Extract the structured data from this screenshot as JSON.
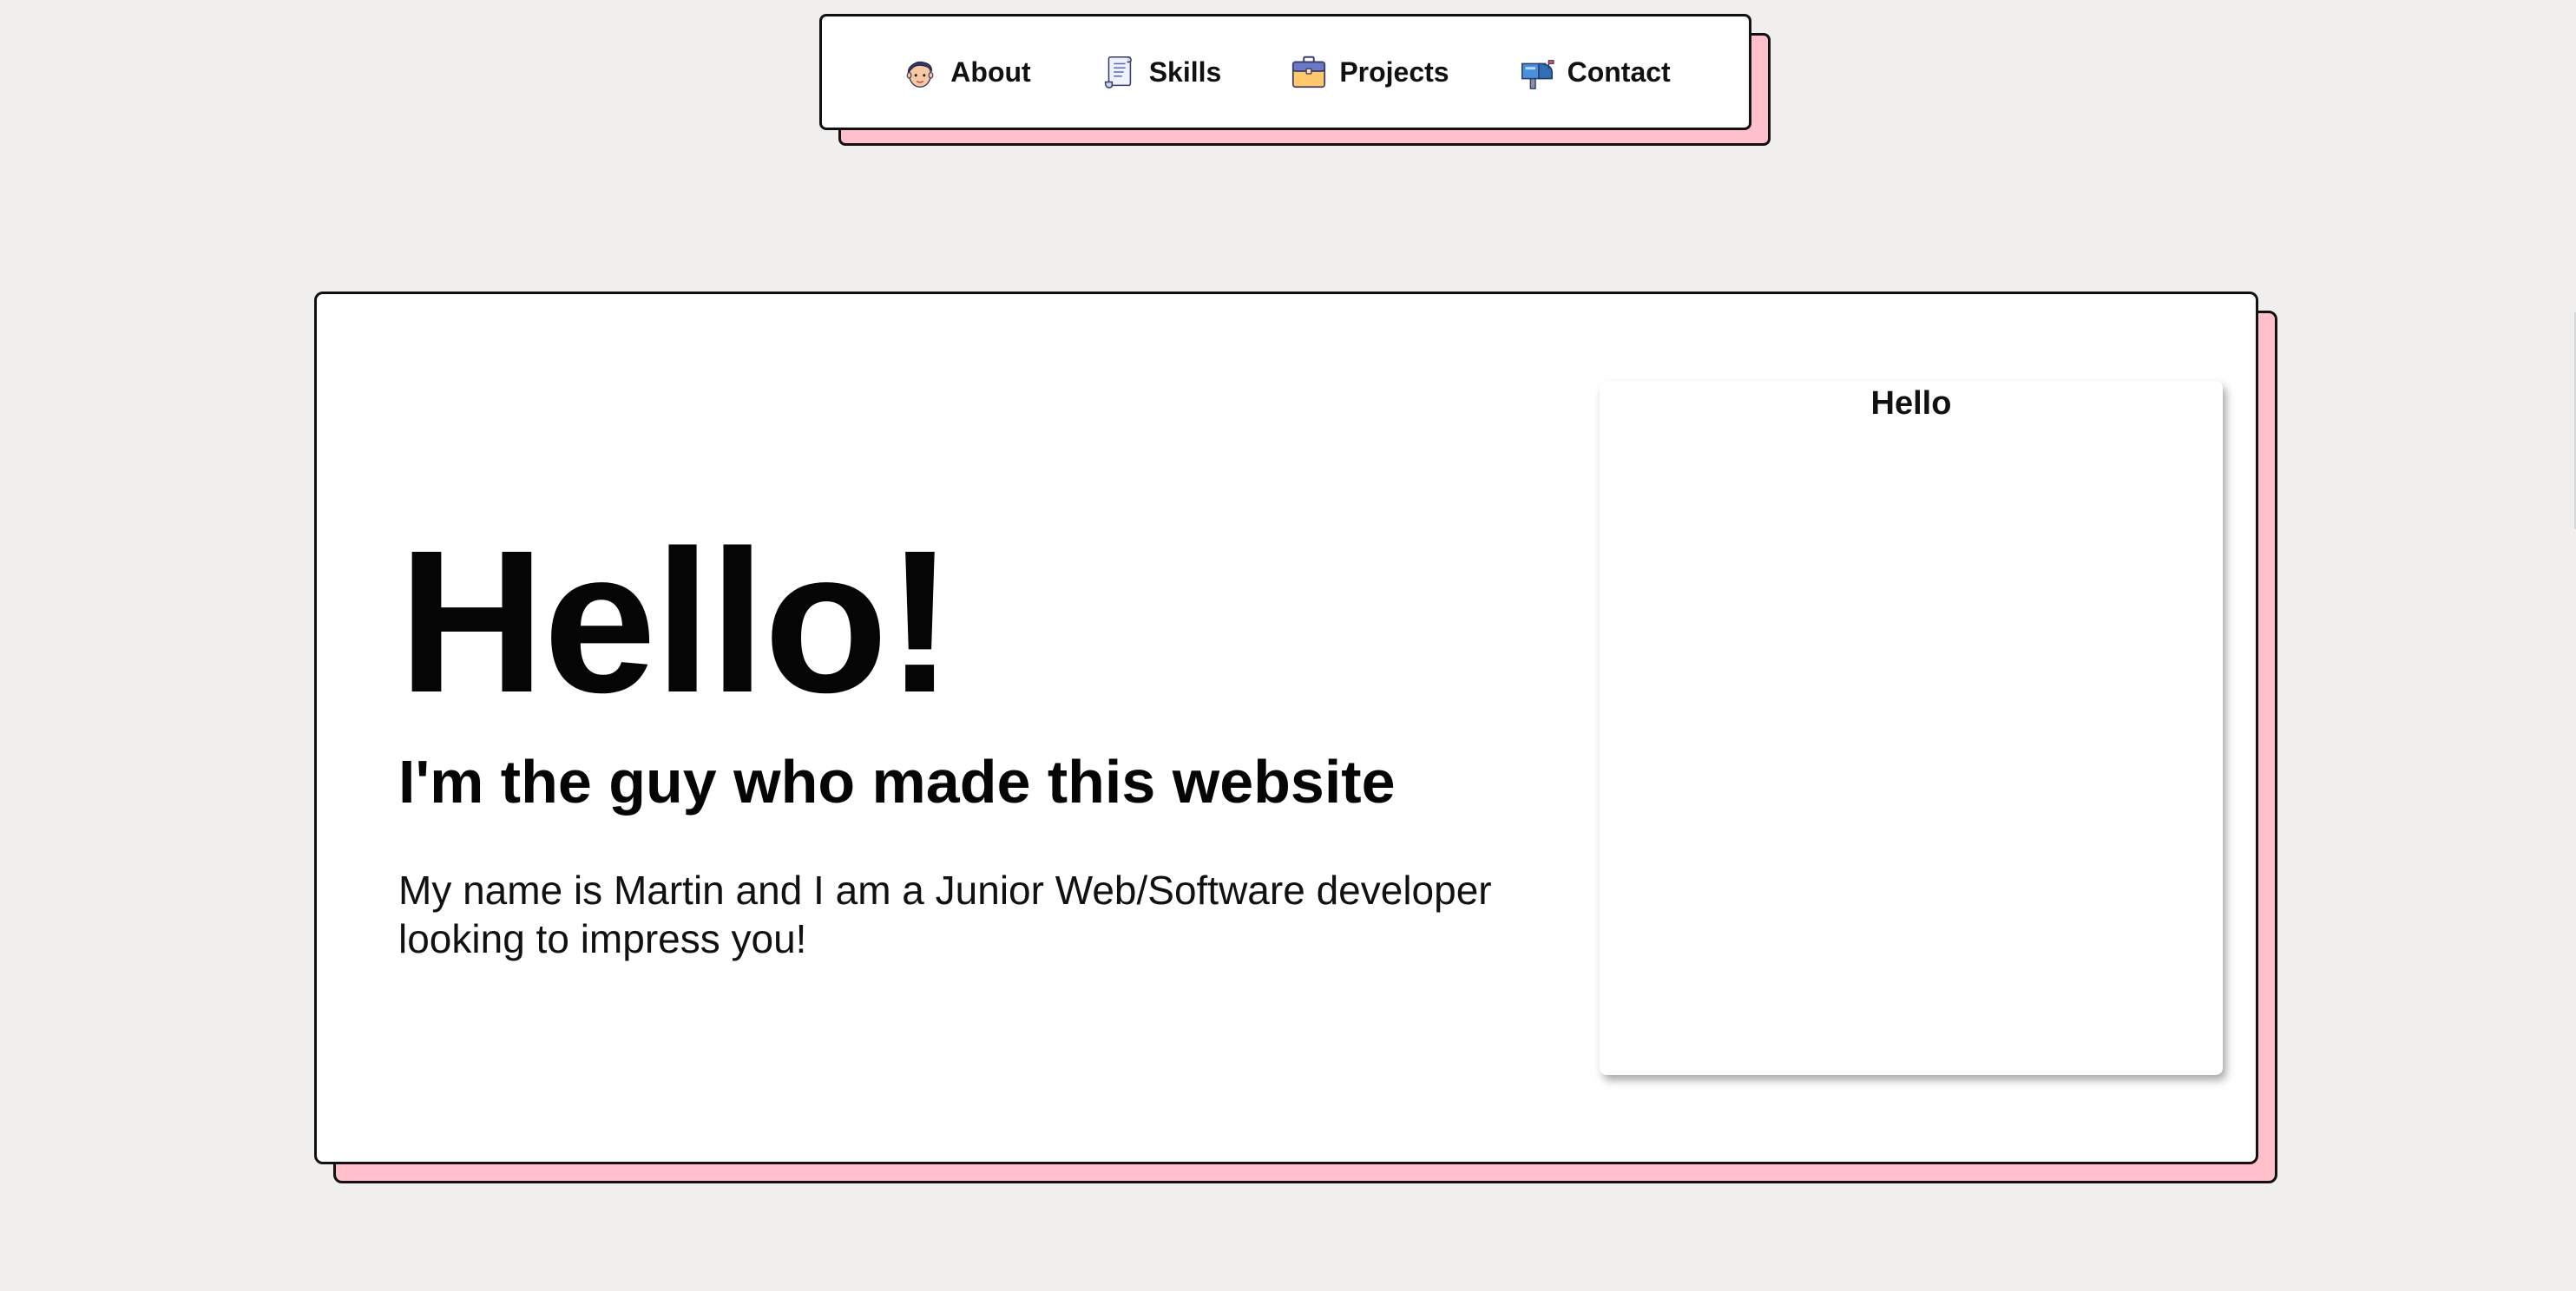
{
  "nav": {
    "items": [
      {
        "label": "About",
        "icon": "face-icon"
      },
      {
        "label": "Skills",
        "icon": "scroll-icon"
      },
      {
        "label": "Projects",
        "icon": "briefcase-icon"
      },
      {
        "label": "Contact",
        "icon": "mailbox-icon"
      }
    ]
  },
  "hero": {
    "title": "Hello!",
    "subtitle": "I'm the guy who made this website",
    "body": "My name is Martin and I am a Junior Web/Software developer looking to impress you!"
  },
  "card": {
    "label": "Hello"
  },
  "colors": {
    "background": "#f0efed",
    "accent_shadow": "#ffc0cb",
    "border": "#111111",
    "card": "#ffffff"
  }
}
